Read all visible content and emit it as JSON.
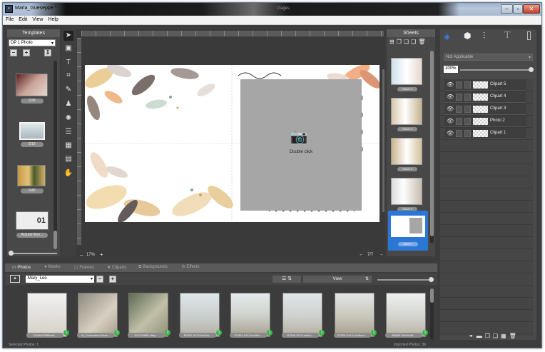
{
  "window": {
    "title": "Maria_Gueseppe *",
    "ghost_text": "Pages"
  },
  "menu": [
    "File",
    "Edit",
    "View",
    "Help"
  ],
  "templates": {
    "header": "Templates",
    "selected_layout": "DP 1 Photo",
    "items": [
      "D39",
      "D19",
      "D40",
      "AutumnTem..."
    ]
  },
  "canvas": {
    "zoom": "17%",
    "page_counter": "7/7",
    "placeholder_text": "Double click"
  },
  "sheets": {
    "header": "Sheets",
    "items": [
      "Sheet 3",
      "Sheet 4",
      "Sheet 5",
      "Sheet 6",
      "Sheet 7"
    ]
  },
  "right_panel": {
    "property_dropdown": "Not Applicable",
    "opacity": "100%",
    "layers": [
      "Clipart 5",
      "Clipart 4",
      "Clipart 3",
      "Photo 2",
      "Clipart 1"
    ]
  },
  "bottom_tabs": [
    "Photos",
    "Masks",
    "Frames",
    "Cliparts",
    "Backgrounds",
    "Effects"
  ],
  "photos": {
    "folder": "Mary_Leo",
    "view_label": "View",
    "items": [
      {
        "caption": "01MMHPBBkakt...",
        "count": "1"
      },
      {
        "caption": "IA_Destination-Bride...",
        "count": "1"
      },
      {
        "caption": "9417b3889-cffbp...",
        "count": "2"
      },
      {
        "caption": "B7697-3413-5a0cfa...",
        "count": "1"
      },
      {
        "caption": "B7591-3413-bc6Ra...",
        "count": "1"
      },
      {
        "caption": "B7598-3413-aa5cb...",
        "count": "1"
      },
      {
        "caption": "B7595-3413-bb46ac4...",
        "count": "1"
      },
      {
        "caption": "B8685-3fa4b6d8...",
        "count": "1"
      }
    ]
  },
  "status": {
    "left": "Selected Photos: 1",
    "right": "Imported Photos: 36"
  },
  "colors": {
    "panel_bg": "#484848",
    "workspace_bg": "#3a3a3a",
    "selected_sheet": "#2a77d6",
    "badge_green": "#3cb34a"
  }
}
